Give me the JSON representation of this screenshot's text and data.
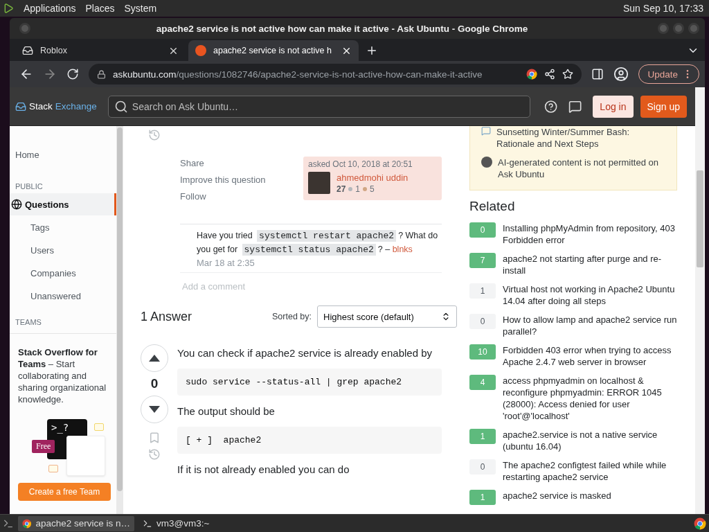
{
  "top_panel": {
    "menus": [
      "Applications",
      "Places",
      "System"
    ],
    "clock": "Sun Sep 10, 17:33"
  },
  "window": {
    "title": "apache2 service is not active how can make it active - Ask Ubuntu - Google Chrome"
  },
  "tabs": [
    {
      "title": "Roblox",
      "selected": false
    },
    {
      "title": "apache2 service is not active h",
      "selected": true
    }
  ],
  "toolbar": {
    "url_host": "askubuntu.com",
    "url_path": "/questions/1082746/apache2-service-is-not-active-how-can-make-it-active",
    "update_label": "Update"
  },
  "site_header": {
    "logo_left": "Stack",
    "logo_right": "Exchange",
    "search_placeholder": "Search on Ask Ubuntu…",
    "login": "Log in",
    "signup": "Sign up"
  },
  "sidebar": {
    "items": [
      {
        "kind": "top",
        "label": "Home",
        "selected": false
      },
      {
        "kind": "heading",
        "label": "PUBLIC"
      },
      {
        "kind": "main",
        "label": "Questions",
        "selected": true
      },
      {
        "kind": "sub",
        "label": "Tags",
        "selected": false
      },
      {
        "kind": "sub",
        "label": "Users",
        "selected": false
      },
      {
        "kind": "sub",
        "label": "Companies",
        "selected": false
      },
      {
        "kind": "sub",
        "label": "Unanswered",
        "selected": false
      },
      {
        "kind": "heading",
        "label": "TEAMS"
      }
    ],
    "promo": {
      "text": "**Stack Overflow for Teams** – Start collaborating and sharing organizational knowledge.",
      "terminal": ">_?",
      "badge": "Free",
      "button": "Create a free Team"
    }
  },
  "question_footer": {
    "actions": [
      "Share",
      "Improve this question",
      "Follow"
    ],
    "asked": "asked Oct 10, 2018 at 20:51",
    "user": "ahmedmohi uddin",
    "reputation": "27",
    "silver": "1",
    "bronze": "5"
  },
  "comments": [
    {
      "parts": [
        {
          "kind": "text",
          "text": "Have you tried"
        },
        {
          "kind": "code",
          "text": "systemctl restart apache2"
        },
        {
          "kind": "text",
          "text": "? What do you get for"
        },
        {
          "kind": "code",
          "text": "systemctl status apache2"
        },
        {
          "kind": "text",
          "text": "? –"
        }
      ],
      "author": "blnks",
      "time": "Mar 18 at 2:35"
    }
  ],
  "add_comment": "Add a comment",
  "answers_header": {
    "count": "1 Answer",
    "sort_label": "Sorted by:",
    "sort_value": "Highest score (default)"
  },
  "answer": {
    "score": "0",
    "blocks": [
      {
        "kind": "text",
        "text": "You can check if apache2 service is already enabled by"
      },
      {
        "kind": "code",
        "text": "sudo service --status-all | grep apache2"
      },
      {
        "kind": "text",
        "text": "The output should be"
      },
      {
        "kind": "code",
        "text": "[ + ]  apache2"
      },
      {
        "kind": "text",
        "text": "If it is not already enabled you can do"
      }
    ]
  },
  "notices": [
    {
      "kind": "chat",
      "text": "Sunsetting Winter/Summer Bash: Rationale and Next Steps"
    },
    {
      "kind": "site",
      "text": "AI-generated content is not permitted on Ask Ubuntu"
    }
  ],
  "related": {
    "title": "Related",
    "items": [
      {
        "score": "0",
        "accepted": true,
        "title": "Installing phpMyAdmin from repository, 403 Forbidden error"
      },
      {
        "score": "7",
        "accepted": true,
        "title": "apache2 not starting after purge and re-install"
      },
      {
        "score": "1",
        "accepted": false,
        "title": "Virtual host not working in Apache2 Ubuntu 14.04 after doing all steps"
      },
      {
        "score": "0",
        "accepted": false,
        "title": "How to allow lamp and apache2 service run parallel?"
      },
      {
        "score": "10",
        "accepted": true,
        "title": "Forbidden 403 error when trying to access Apache 2.4.7 web server in browser"
      },
      {
        "score": "4",
        "accepted": true,
        "title": "access phpmyadmin on localhost & reconfigure phpmyadmin: ERROR 1045 (28000): Access denied for user 'root'@'localhost'"
      },
      {
        "score": "1",
        "accepted": true,
        "title": "apache2.service is not a native service (ubuntu 16.04)"
      },
      {
        "score": "0",
        "accepted": false,
        "title": "The apache2 configtest failed while while restarting apache2 service"
      },
      {
        "score": "1",
        "accepted": true,
        "title": "apache2 service is masked"
      }
    ]
  },
  "taskbar": {
    "items": [
      {
        "kind": "browser",
        "label": "apache2 service is n…",
        "selected": true
      },
      {
        "kind": "terminal",
        "label": "vm3@vm3:~",
        "selected": false
      }
    ]
  }
}
